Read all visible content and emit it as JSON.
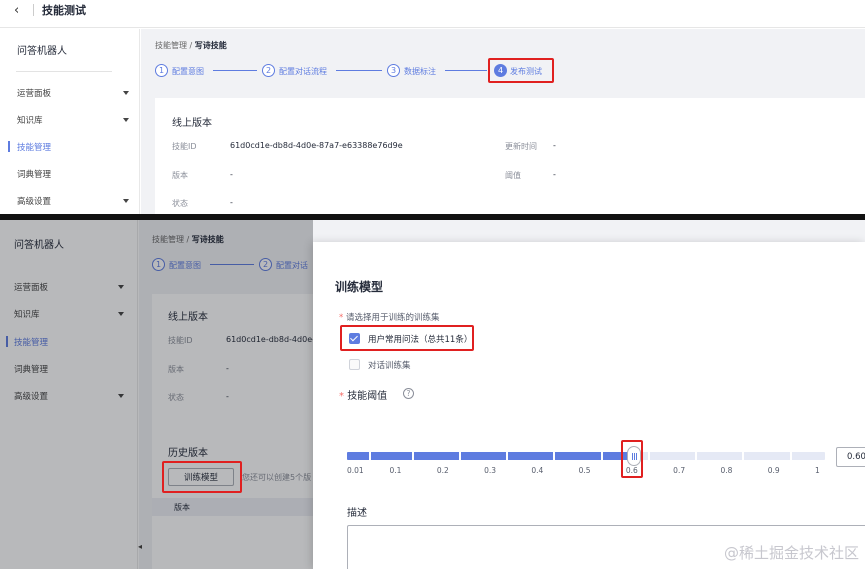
{
  "top": {
    "header": {
      "back_icon": "chevron-left-icon",
      "title": "技能测试"
    },
    "sidebar": {
      "bot_name": "问答机器人",
      "items": [
        {
          "label": "运营面板",
          "has_caret": true
        },
        {
          "label": "知识库",
          "has_caret": true
        },
        {
          "label": "技能管理",
          "active": true
        },
        {
          "label": "词典管理"
        },
        {
          "label": "高级设置",
          "has_caret": true
        }
      ]
    },
    "breadcrumb": {
      "parent": "技能管理",
      "sep": "/",
      "current": "写诗技能"
    },
    "steps": [
      {
        "num": "1",
        "label": "配置意图"
      },
      {
        "num": "2",
        "label": "配置对话流程"
      },
      {
        "num": "3",
        "label": "数据标注"
      },
      {
        "num": "4",
        "label": "发布测试",
        "active": true
      }
    ],
    "online_card": {
      "title": "线上版本",
      "skill_id_label": "技能ID",
      "skill_id_value": "61d0cd1e-db8d-4d0e-87a7-e63388e76d9e",
      "update_time_label": "更新时间",
      "update_time_value": "-",
      "version_label": "版本",
      "version_value": "-",
      "threshold_label": "阈值",
      "threshold_value": "-",
      "status_label": "状态",
      "status_value": "-"
    }
  },
  "bottom": {
    "sidebar": {
      "bot_name": "问答机器人",
      "items": [
        {
          "label": "运营面板",
          "has_caret": true
        },
        {
          "label": "知识库",
          "has_caret": true
        },
        {
          "label": "技能管理",
          "active": true
        },
        {
          "label": "词典管理"
        },
        {
          "label": "高级设置",
          "has_caret": true
        }
      ]
    },
    "breadcrumb": {
      "parent": "技能管理",
      "sep": "/",
      "current": "写诗技能"
    },
    "steps": [
      {
        "num": "1",
        "label": "配置意图"
      },
      {
        "num": "2",
        "label": "配置对话"
      }
    ],
    "online_card": {
      "title": "线上版本",
      "skill_id_label": "技能ID",
      "skill_id_value": "61d0cd1e-db8d-4d0e-",
      "version_label": "版本",
      "version_value": "-",
      "status_label": "状态",
      "status_value": "-"
    },
    "history": {
      "title": "历史版本",
      "train_button": "训练模型",
      "hint": "您还可以创建5个版",
      "table_header_version": "版本"
    },
    "dialog": {
      "title": "训练模型",
      "trainset_label": "请选择用于训练的训练集",
      "options": [
        {
          "label": "用户常用问法（总共11条）",
          "checked": true
        },
        {
          "label": "对话训练集",
          "checked": false
        }
      ],
      "threshold_label": "技能阈值",
      "help_icon": "question-circle-icon",
      "slider": {
        "min": 0.01,
        "max": 1,
        "value": 0.6,
        "ticks": [
          "0.01",
          "0.1",
          "0.2",
          "0.3",
          "0.4",
          "0.5",
          "0.6",
          "0.7",
          "0.8",
          "0.9",
          "1"
        ]
      },
      "threshold_input_value": "0.60",
      "description_label": "描述"
    }
  },
  "watermark": "@稀土掘金技术社区",
  "colors": {
    "accent": "#5e7ce0",
    "highlight": "#e02020",
    "page_bg": "#f1f2f5"
  }
}
